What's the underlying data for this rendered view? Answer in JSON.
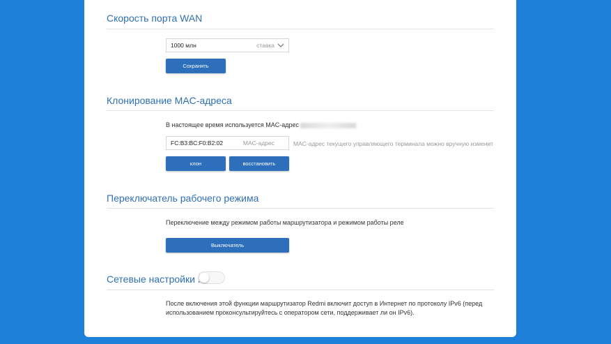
{
  "wan": {
    "title": "Скорость порта WAN",
    "speed_value": "1000 млн",
    "speed_unit": "ставка",
    "save_label": "Сохранять"
  },
  "mac": {
    "title": "Клонирование MAC-адреса",
    "current_text": "В настоящее время используется MAC-адрес",
    "input_value": "FC:B3:BC:F0:B2:02",
    "input_unit": "MAC-адрес",
    "hint": "MAC-адрес текущего управляющего терминала можно вручную изменить н",
    "clone_label": "клон",
    "restore_label": "восстановить"
  },
  "mode": {
    "title": "Переключатель рабочего режима",
    "description": "Переключение между режимом работы маршрутизатора и режимом работы реле",
    "switch_label": "Выключатель"
  },
  "ipv6": {
    "title": "Сетевые настройки IPV6",
    "enabled": false,
    "description_line1": "После включения этой функции маршрутизатор Redmi включит доступ в Интернет по протоколу IPv6 (перед",
    "description_line2": "использованием проконсультируйтесь с оператором сети, поддерживает ли он IPv6)."
  },
  "colors": {
    "background": "#1e7fd8",
    "accent": "#2d6fba",
    "title": "#2f6fb3"
  }
}
